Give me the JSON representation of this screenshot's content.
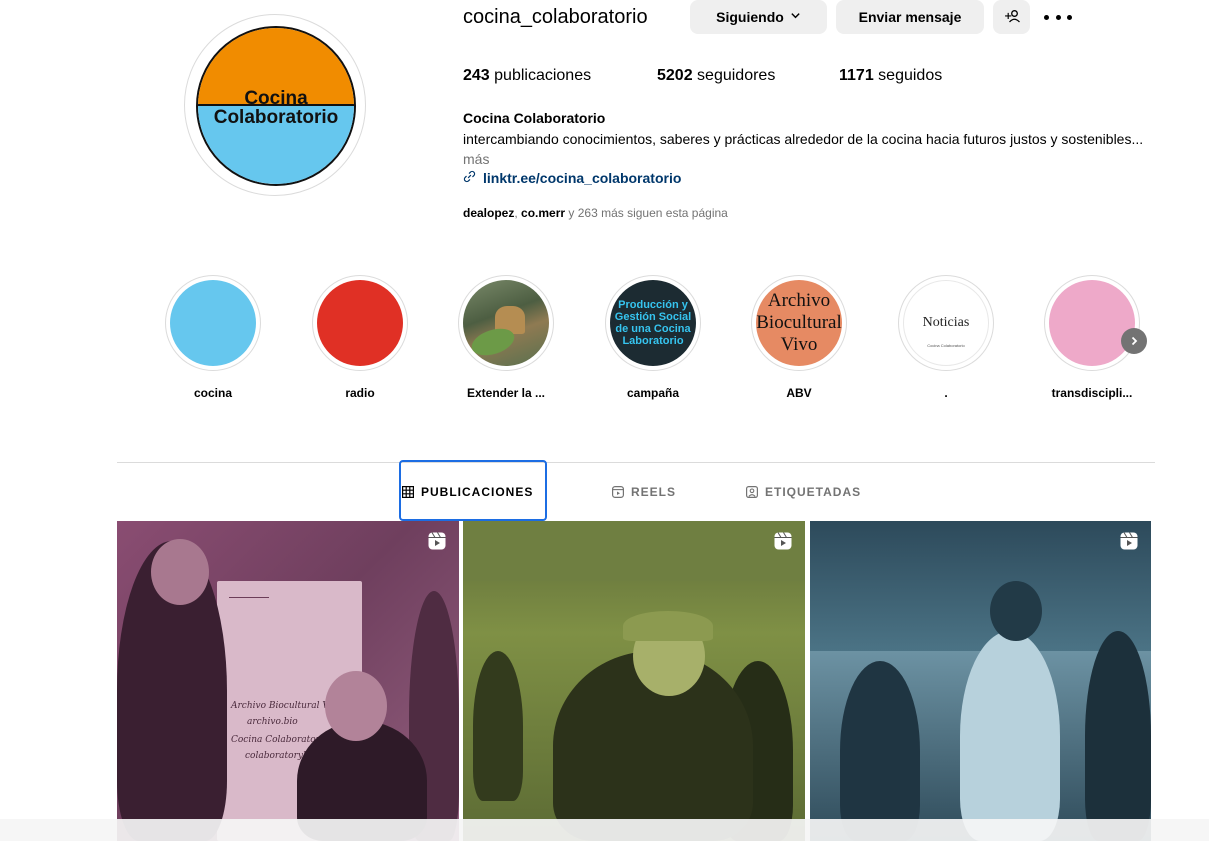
{
  "profile": {
    "username": "cocina_colaboratorio",
    "avatar_text_line1": "Cocina",
    "avatar_text_line2": "Colaboratorio",
    "following_button": "Siguiendo",
    "message_button": "Enviar mensaje",
    "stats": {
      "posts_count": "243",
      "posts_label": " publicaciones",
      "followers_count": "5202",
      "followers_label": " seguidores",
      "following_count": "1171",
      "following_label": " seguidos"
    },
    "bio": {
      "name": "Cocina Colaboratorio",
      "text": "intercambiando conocimientos, saberes y prácticas alrededor de la cocina hacia futuros justos y sostenibles...",
      "more": " más",
      "link": "linktr.ee/cocina_colaboratorio"
    },
    "followed_by": {
      "user1": "dealopez",
      "sep": ", ",
      "user2": "co.merr",
      "rest": " y 263 más siguen esta página"
    }
  },
  "highlights": [
    {
      "label": "cocina"
    },
    {
      "label": "radio"
    },
    {
      "label": "Extender la ..."
    },
    {
      "label": "campaña",
      "cover_text": "Producción y Gestión Social de una Cocina Laboratorio"
    },
    {
      "label": "ABV",
      "cover_text_1": "Archivo",
      "cover_text_2": "Biocultural",
      "cover_text_3": "Vivo"
    },
    {
      "label": ".",
      "cover_text": "Noticias",
      "cover_small": "Cocina Colaboratorio"
    },
    {
      "label": "transdiscipli..."
    }
  ],
  "tabs": {
    "posts": "PUBLICACIONES",
    "reels": "REELS",
    "tagged": "ETIQUETADAS"
  },
  "post1_board": {
    "line1": "Archivo Biocultural Vivo",
    "line2": "archivo.bio",
    "line3": "Cocina Colaboratorio",
    "line4": "colaboratorykitchen..."
  },
  "colors": {
    "link": "#00376b",
    "button_bg": "#efefef",
    "muted": "#737373",
    "avatar_orange": "#f18c00",
    "avatar_blue": "#66c7ee",
    "focus_ring": "#1c6de3"
  },
  "icons": [
    "chevron-down-icon",
    "add-person-icon",
    "more-options-icon",
    "link-icon",
    "grid-icon",
    "reels-icon",
    "tagged-icon",
    "reel-badge-icon",
    "chevron-right-icon"
  ]
}
